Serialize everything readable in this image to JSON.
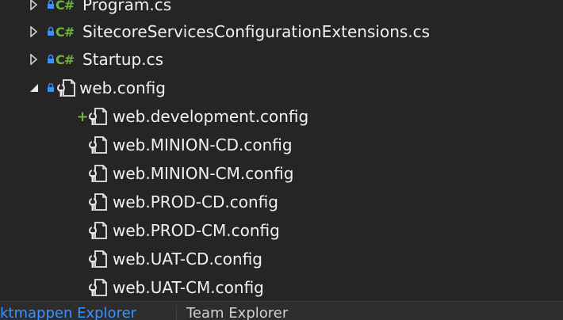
{
  "colors": {
    "background": "#252526",
    "text": "#f1f1f1",
    "csharp": "#6db33f",
    "lock": "#3794ff",
    "tab_active": "#3794ff"
  },
  "tree": {
    "items": [
      {
        "label": "Program.cs",
        "icon": "csharp-file-icon",
        "lock": true
      },
      {
        "label": "SitecoreServicesConfigurationExtensions.cs",
        "icon": "csharp-file-icon",
        "lock": true
      },
      {
        "label": "Startup.cs",
        "icon": "csharp-file-icon",
        "lock": true
      },
      {
        "label": "web.config",
        "icon": "config-file-icon",
        "lock": true,
        "expanded": true
      }
    ],
    "children": [
      {
        "label": "web.development.config",
        "icon": "config-file-icon",
        "added": true
      },
      {
        "label": "web.MINION-CD.config",
        "icon": "config-file-icon"
      },
      {
        "label": "web.MINION-CM.config",
        "icon": "config-file-icon"
      },
      {
        "label": "web.PROD-CD.config",
        "icon": "config-file-icon"
      },
      {
        "label": "web.PROD-CM.config",
        "icon": "config-file-icon"
      },
      {
        "label": "web.UAT-CD.config",
        "icon": "config-file-icon"
      },
      {
        "label": "web.UAT-CM.config",
        "icon": "config-file-icon"
      }
    ],
    "csharp_badge": "C#",
    "added_marker": "+"
  },
  "tabs": [
    {
      "label": "ktmappen Explorer"
    },
    {
      "label": "Team Explorer"
    }
  ]
}
